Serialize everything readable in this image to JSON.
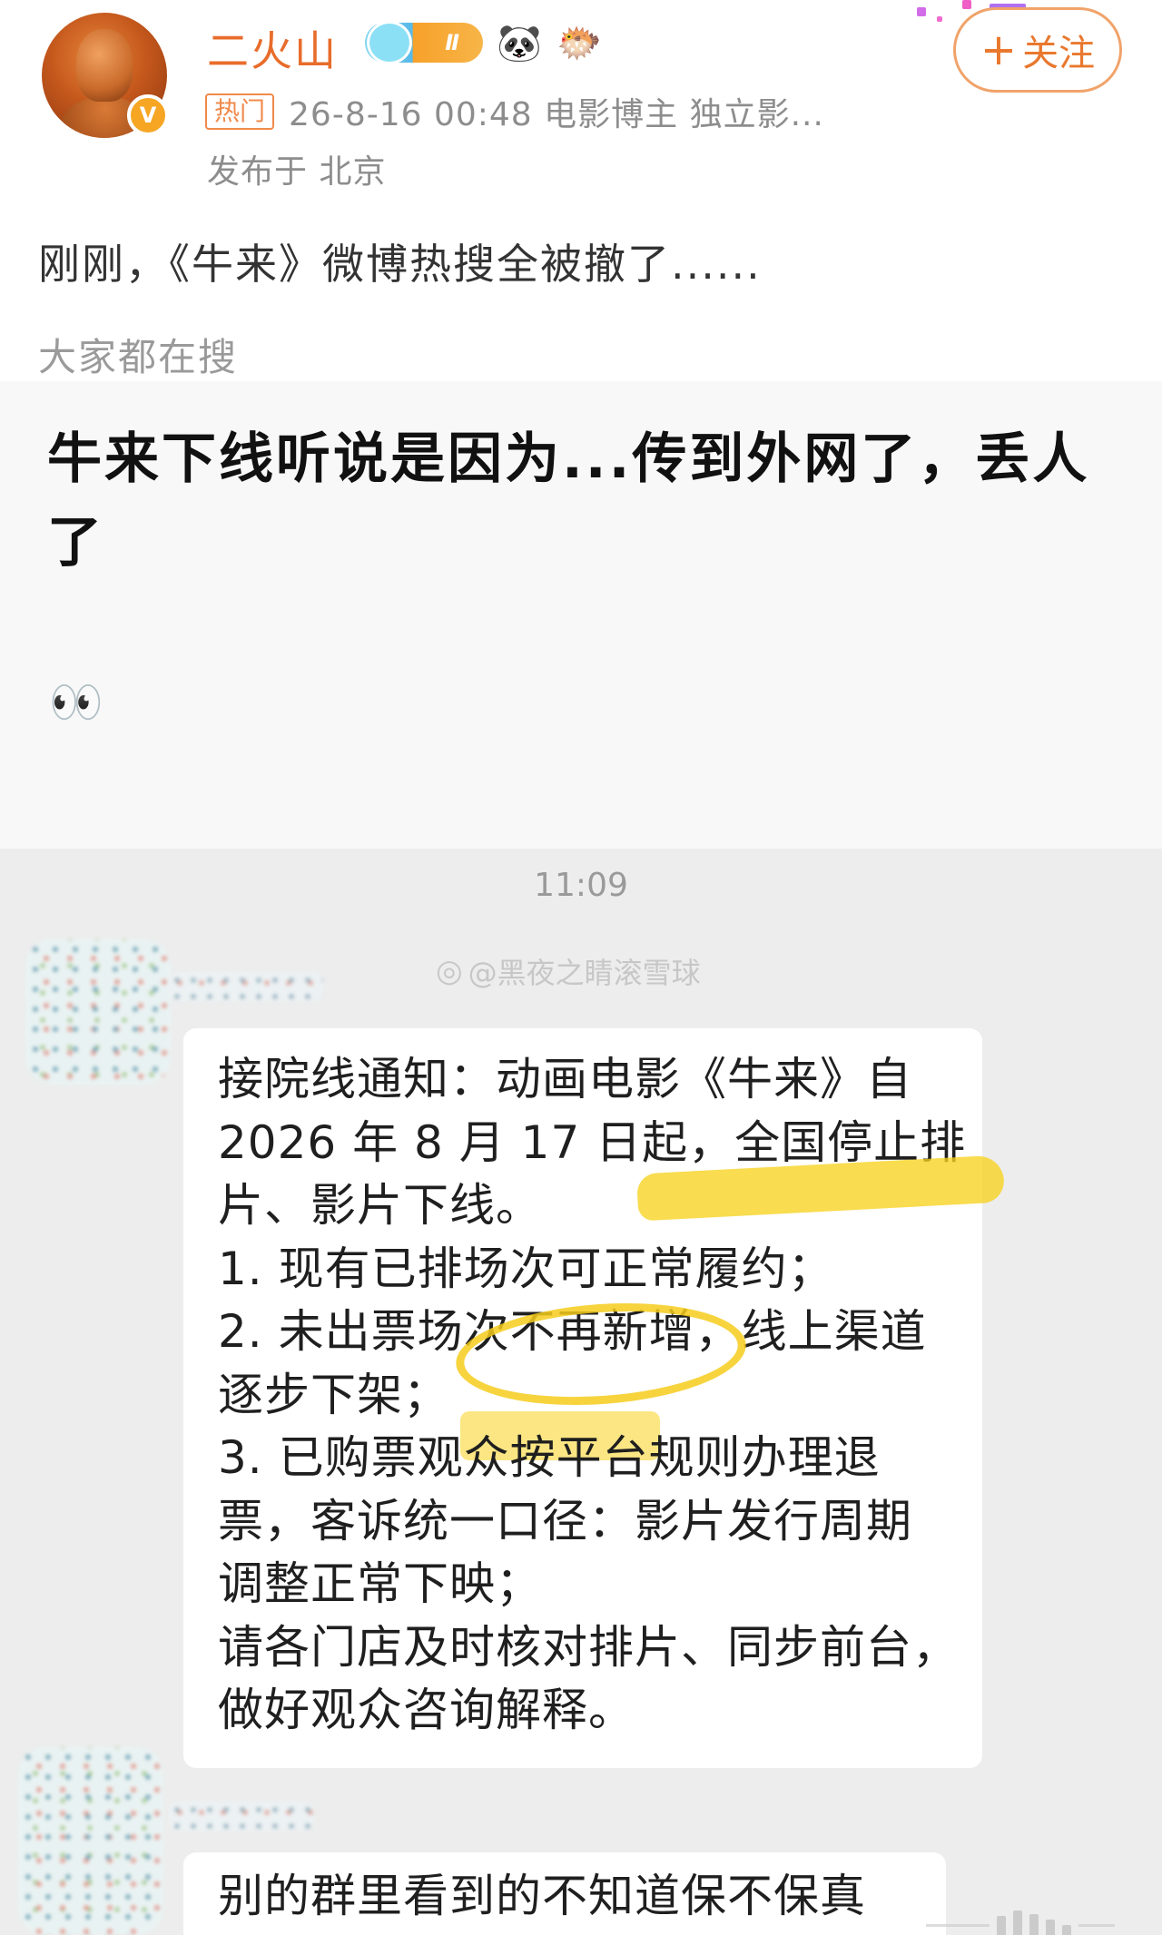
{
  "post": {
    "username": "二火山",
    "level_badge": "Ⅱ",
    "badge_icons": [
      "panda-emoji",
      "fish-emoji"
    ],
    "verified_mark": "V",
    "hot_tag": "热门",
    "meta": "26-8-16 00:48  电影博主 独立影...",
    "location": "发布于 北京",
    "follow_plus": "+",
    "follow_label": "关注",
    "text": "刚刚，《牛来》微博热搜全被撤了......",
    "search_label": "大家都在搜",
    "card_title": "牛来下线听说是因为...传到外网了，丢人了",
    "emoji": "👀"
  },
  "chat": {
    "time": "11:09",
    "watermark": "@黑夜之睛滚雪球",
    "message_lines": [
      "接院线通知：动画电影《牛来》自",
      "2026 年 8 月 17 日起，全国停止排",
      "片、影片下线。",
      "1. 现有已排场次可正常履约；",
      "2. 未出票场次不再新增，线上渠道",
      "逐步下架；",
      "3. 已购票观众按平台规则办理退",
      "票，客诉统一口径：影片发行周期",
      "调整正常下映；",
      "请各门店及时核对排片、同步前台，",
      "做好观众咨询解释。"
    ],
    "last_message": "别的群里看到的不知道保不保真"
  },
  "colors": {
    "username": "#e86c2b",
    "follow": "#e9782e",
    "highlight": "#f7d21e",
    "chat_bg": "#ededed"
  }
}
